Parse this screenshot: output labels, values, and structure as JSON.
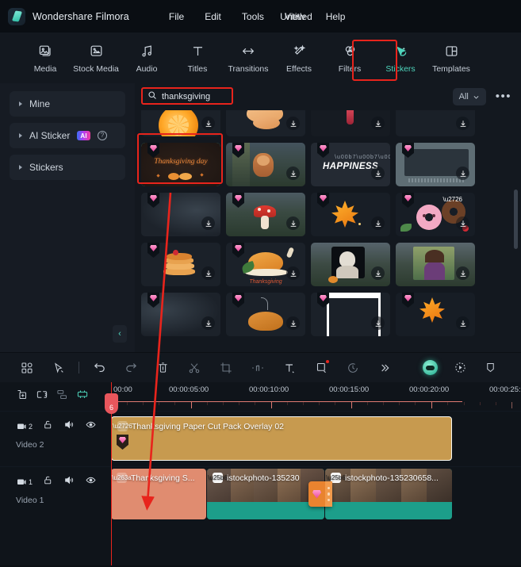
{
  "app": {
    "brand": "Wondershare Filmora",
    "document_title": "Untitled",
    "logo_icon": "filmora-logo-icon"
  },
  "menubar": [
    {
      "label": "File",
      "name": "menu-file"
    },
    {
      "label": "Edit",
      "name": "menu-edit"
    },
    {
      "label": "Tools",
      "name": "menu-tools"
    },
    {
      "label": "View",
      "name": "menu-view"
    },
    {
      "label": "Help",
      "name": "menu-help"
    }
  ],
  "ribbon": {
    "active_tab": "Stickers",
    "highlight_color": "#e8241c",
    "accent_color": "#4fd6bd",
    "tabs": [
      {
        "label": "Media",
        "icon": "media-icon"
      },
      {
        "label": "Stock Media",
        "icon": "stock-media-icon"
      },
      {
        "label": "Audio",
        "icon": "audio-note-icon"
      },
      {
        "label": "Titles",
        "icon": "titles-text-icon"
      },
      {
        "label": "Transitions",
        "icon": "transitions-arrows-icon"
      },
      {
        "label": "Effects",
        "icon": "effects-sparkle-icon"
      },
      {
        "label": "Filters",
        "icon": "filters-circles-icon"
      },
      {
        "label": "Stickers",
        "icon": "stickers-cursor-icon"
      },
      {
        "label": "Templates",
        "icon": "templates-grid-icon"
      }
    ]
  },
  "library": {
    "sidebar": [
      {
        "label": "Mine",
        "icon": "chevron-right-icon",
        "badge": null
      },
      {
        "label": "AI Sticker",
        "icon": "chevron-right-icon",
        "badge": "AI",
        "help": "?"
      },
      {
        "label": "Stickers",
        "icon": "chevron-right-icon",
        "badge": null
      }
    ],
    "collapse_label": "‹",
    "search": {
      "value": "thanksgiving",
      "placeholder": "Search",
      "icon": "search-icon",
      "highlighted": true
    },
    "filter": {
      "label": "All",
      "icon": "chevron-down-icon"
    },
    "more_label": "•••",
    "selected_sticker": "Thanksgiving day",
    "grid": [
      {
        "name": "orange-slice-sticker",
        "caption": "",
        "kind": "fruit"
      },
      {
        "name": "turkey-drumstick-sticker",
        "caption": "",
        "kind": "food"
      },
      {
        "name": "candle-sticker",
        "caption": "",
        "kind": "dark"
      },
      {
        "name": "dark-thumb-sticker",
        "caption": "",
        "kind": "dark"
      },
      {
        "name": "thanksgiving-day-sticker",
        "caption": "Thanksgiving day",
        "kind": "selected"
      },
      {
        "name": "squirrel-sticker",
        "caption": "",
        "kind": "photo"
      },
      {
        "name": "happiness-text-sticker",
        "caption": "HAPPINESS",
        "kind": "text"
      },
      {
        "name": "frame-overlay-sticker",
        "caption": "",
        "kind": "frame"
      },
      {
        "name": "blur-dark-sticker",
        "caption": "",
        "kind": "dark"
      },
      {
        "name": "mushroom-sticker",
        "caption": "",
        "kind": "photo"
      },
      {
        "name": "maple-leaf-sticker",
        "caption": "",
        "kind": "leaf"
      },
      {
        "name": "donuts-sticker",
        "caption": "",
        "kind": "donut"
      },
      {
        "name": "pancakes-sticker",
        "caption": "",
        "kind": "pancake"
      },
      {
        "name": "roast-turkey-sticker",
        "caption": "Thanksgiving",
        "kind": "turkey"
      },
      {
        "name": "statue-portrait-sticker",
        "caption": "",
        "kind": "portrait"
      },
      {
        "name": "woman-portrait-sticker",
        "caption": "",
        "kind": "portrait2"
      },
      {
        "name": "dark-gradient-sticker",
        "caption": "",
        "kind": "dark"
      },
      {
        "name": "roast-bird-sticker",
        "caption": "",
        "kind": "turkey2"
      },
      {
        "name": "white-frame-sticker",
        "caption": "",
        "kind": "whiteframe"
      },
      {
        "name": "orange-leaf-sticker",
        "caption": "",
        "kind": "leaf2"
      }
    ]
  },
  "edit_toolbar": {
    "buttons": [
      {
        "name": "layout-grid-button",
        "icon": "layout-grid-icon"
      },
      {
        "name": "select-tool-button",
        "icon": "cursor-select-icon"
      },
      {
        "name": "undo-button",
        "icon": "undo-arrow-icon"
      },
      {
        "name": "redo-button",
        "icon": "redo-arrow-icon"
      },
      {
        "name": "delete-button",
        "icon": "trash-icon"
      },
      {
        "name": "split-button",
        "icon": "scissors-icon"
      },
      {
        "name": "crop-button",
        "icon": "crop-icon"
      },
      {
        "name": "audio-detach-button",
        "icon": "audio-split-icon"
      },
      {
        "name": "text-tool-button",
        "icon": "text-t-icon"
      },
      {
        "name": "mask-tool-button",
        "icon": "square-mask-icon",
        "badge": "dot"
      },
      {
        "name": "speed-button",
        "icon": "speed-clock-icon"
      },
      {
        "name": "more-tools-button",
        "icon": "chevrons-right-icon"
      }
    ],
    "right_buttons": [
      {
        "name": "ai-copilot-button",
        "icon": "ai-copilot-icon"
      },
      {
        "name": "render-preview-button",
        "icon": "render-preview-icon"
      },
      {
        "name": "marker-button",
        "icon": "marker-shield-icon"
      }
    ]
  },
  "timeline": {
    "tools": [
      {
        "name": "add-media-button",
        "icon": "add-media-icon"
      },
      {
        "name": "link-group-button",
        "icon": "group-link-icon"
      },
      {
        "name": "manage-tracks-button",
        "icon": "manage-tracks-icon"
      },
      {
        "name": "auto-adjust-button",
        "icon": "auto-adjust-icon"
      }
    ],
    "ruler_ticks": [
      "00:00",
      "00:00:05:00",
      "00:00:10:00",
      "00:00:15:00",
      "00:00:20:00",
      "00:00:25:"
    ],
    "playhead_label": "6",
    "tracks": [
      {
        "name": "Video 2",
        "index": "2",
        "icons": [
          "track-video-icon",
          "lock-icon",
          "mute-speaker-icon",
          "eye-visible-icon"
        ],
        "clips": [
          {
            "name": "sticker-overlay-clip",
            "title": "Thanksgiving Paper Cut Pack Overlay 02",
            "color": "#c79a4f",
            "selected": true,
            "icon": "sticker-clip-icon",
            "has_gem": true
          }
        ]
      },
      {
        "name": "Video 1",
        "index": "1",
        "icons": [
          "track-video-icon",
          "lock-icon",
          "mute-speaker-icon",
          "eye-visible-icon"
        ],
        "clips": [
          {
            "name": "sticker-clip",
            "title": "Thanksgiving S...",
            "color": "#e08c70",
            "icon": "sticker-clip-icon"
          },
          {
            "name": "video-clip-1",
            "title": "istockphoto-135230",
            "color": "#1c9e8a",
            "icon": "play-clip-icon"
          },
          {
            "name": "video-clip-2",
            "title": "istockphoto-135230658...",
            "color": "#1c9e8a",
            "icon": "play-clip-icon"
          }
        ]
      }
    ],
    "drag_badge": {
      "name": "drag-sticker-badge",
      "icon": "gem-icon"
    }
  },
  "annotations": {
    "arrow_color": "#e8241c",
    "boxes": [
      {
        "name": "stickers-tab-highlight"
      },
      {
        "name": "search-field-highlight"
      },
      {
        "name": "selected-sticker-highlight"
      }
    ],
    "arrow": {
      "name": "drag-direction-arrow",
      "from": "selected-sticker",
      "to": "timeline-track"
    }
  }
}
